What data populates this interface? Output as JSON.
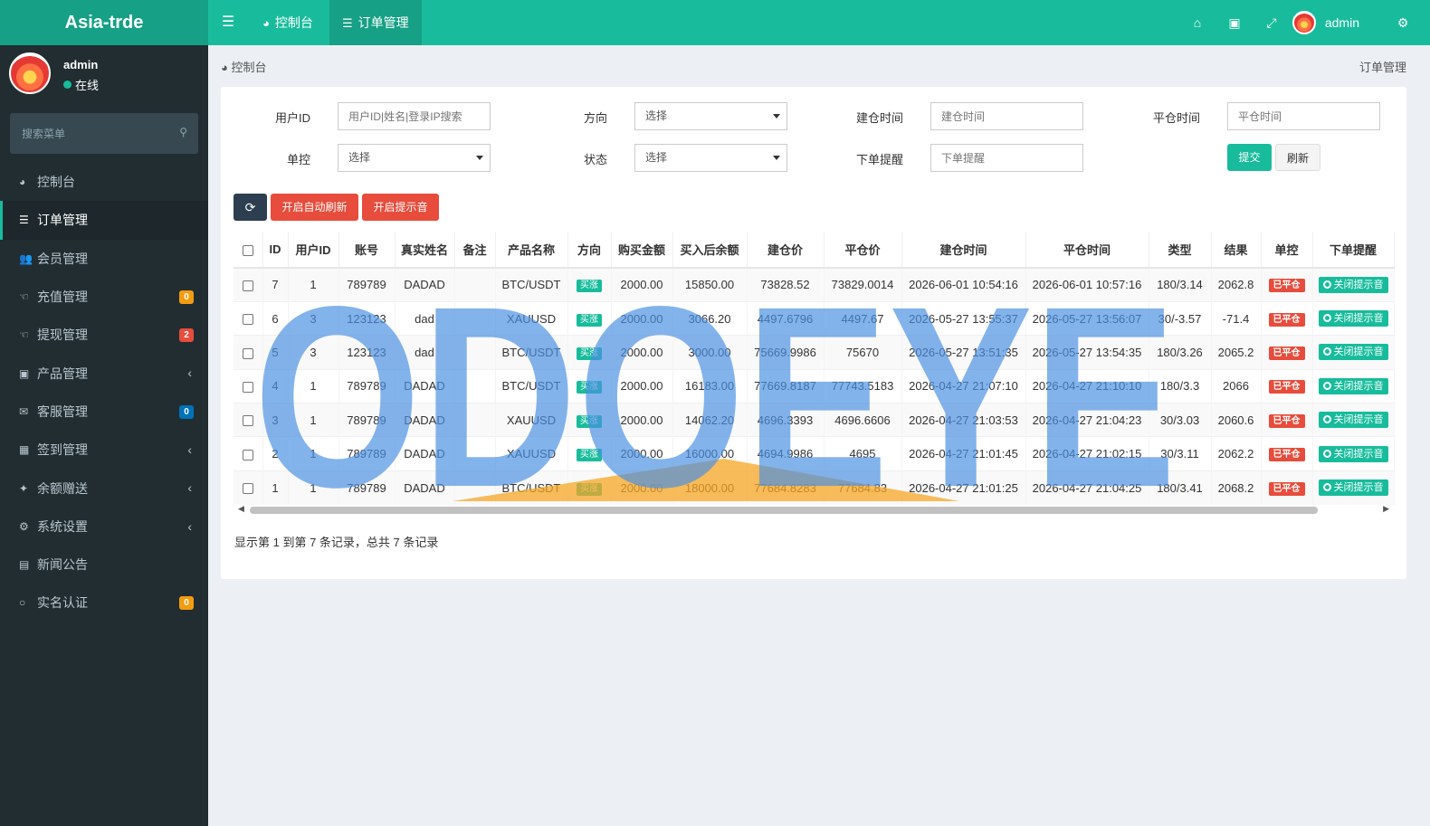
{
  "header": {
    "logo": "Asia-trde",
    "tabs": [
      {
        "label": "控制台",
        "icon": "dashboard-icon"
      },
      {
        "label": "订单管理",
        "icon": "list-icon"
      }
    ],
    "username": "admin"
  },
  "sidebar": {
    "username": "admin",
    "status": "在线",
    "search_placeholder": "搜索菜单",
    "items": [
      {
        "label": "控制台",
        "icon": "dashboard-icon"
      },
      {
        "label": "订单管理",
        "icon": "list-icon",
        "active": true
      },
      {
        "label": "会员管理",
        "icon": "users-icon"
      },
      {
        "label": "充值管理",
        "icon": "hand-icon",
        "badge": "0",
        "badge_color": "#f39c12"
      },
      {
        "label": "提现管理",
        "icon": "hand-icon",
        "badge": "2",
        "badge_color": "#e74c3c"
      },
      {
        "label": "产品管理",
        "icon": "briefcase-icon",
        "chevron": true
      },
      {
        "label": "客服管理",
        "icon": "comments-icon",
        "badge": "0",
        "badge_color": "#0073b7"
      },
      {
        "label": "签到管理",
        "icon": "calendar-icon",
        "chevron": true
      },
      {
        "label": "余额赠送",
        "icon": "gift-icon",
        "chevron": true
      },
      {
        "label": "系统设置",
        "icon": "cogs-icon",
        "chevron": true
      },
      {
        "label": "新闻公告",
        "icon": "newspaper-icon"
      },
      {
        "label": "实名认证",
        "icon": "circle-icon",
        "badge": "0",
        "badge_color": "#f39c12"
      }
    ]
  },
  "breadcrumb": {
    "home": "控制台",
    "current": "订单管理"
  },
  "filters": {
    "user_id": {
      "label": "用户ID",
      "placeholder": "用户ID|姓名|登录IP搜索"
    },
    "direction": {
      "label": "方向",
      "value": "选择"
    },
    "open_time": {
      "label": "建仓时间",
      "placeholder": "建仓时间"
    },
    "close_time": {
      "label": "平仓时间",
      "placeholder": "平仓时间"
    },
    "control": {
      "label": "单控",
      "value": "选择"
    },
    "status": {
      "label": "状态",
      "value": "选择"
    },
    "remind": {
      "label": "下单提醒",
      "placeholder": "下单提醒"
    },
    "submit": "提交",
    "reset": "刷新"
  },
  "toolbar": {
    "auto_refresh": "开启自动刷新",
    "sound": "开启提示音"
  },
  "table": {
    "columns": [
      "ID",
      "用户ID",
      "账号",
      "真实姓名",
      "备注",
      "产品名称",
      "方向",
      "购买金额",
      "买入后余额",
      "建仓价",
      "平仓价",
      "建仓时间",
      "平仓时间",
      "类型",
      "结果",
      "单控",
      "下单提醒"
    ],
    "rows": [
      {
        "id": "7",
        "uid": "1",
        "account": "789789",
        "name": "DADAD",
        "note": "",
        "product": "BTC/USDT",
        "dir": "买涨",
        "amount": "2000.00",
        "balance": "15850.00",
        "open": "73828.52",
        "close": "73829.0014",
        "open_time": "2026-06-01 10:54:16",
        "close_time": "2026-06-01 10:57:16",
        "type": "180/3.14",
        "result": "2062.8",
        "control": "已平仓",
        "remind": "关闭提示音"
      },
      {
        "id": "6",
        "uid": "3",
        "account": "123123",
        "name": "dad",
        "note": "",
        "product": "XAUUSD",
        "dir": "买涨",
        "amount": "2000.00",
        "balance": "3066.20",
        "open": "4497.6796",
        "close": "4497.67",
        "open_time": "2026-05-27 13:55:37",
        "close_time": "2026-05-27 13:56:07",
        "type": "30/-3.57",
        "result": "-71.4",
        "control": "已平仓",
        "remind": "关闭提示音"
      },
      {
        "id": "5",
        "uid": "3",
        "account": "123123",
        "name": "dad",
        "note": "",
        "product": "BTC/USDT",
        "dir": "买涨",
        "amount": "2000.00",
        "balance": "3000.00",
        "open": "75669.9986",
        "close": "75670",
        "open_time": "2026-05-27 13:51:35",
        "close_time": "2026-05-27 13:54:35",
        "type": "180/3.26",
        "result": "2065.2",
        "control": "已平仓",
        "remind": "关闭提示音"
      },
      {
        "id": "4",
        "uid": "1",
        "account": "789789",
        "name": "DADAD",
        "note": "",
        "product": "BTC/USDT",
        "dir": "买涨",
        "amount": "2000.00",
        "balance": "16183.00",
        "open": "77669.8187",
        "close": "77743.5183",
        "open_time": "2026-04-27 21:07:10",
        "close_time": "2026-04-27 21:10:10",
        "type": "180/3.3",
        "result": "2066",
        "control": "已平仓",
        "remind": "关闭提示音"
      },
      {
        "id": "3",
        "uid": "1",
        "account": "789789",
        "name": "DADAD",
        "note": "",
        "product": "XAUUSD",
        "dir": "买涨",
        "amount": "2000.00",
        "balance": "14062.20",
        "open": "4696.3393",
        "close": "4696.6606",
        "open_time": "2026-04-27 21:03:53",
        "close_time": "2026-04-27 21:04:23",
        "type": "30/3.03",
        "result": "2060.6",
        "control": "已平仓",
        "remind": "关闭提示音"
      },
      {
        "id": "2",
        "uid": "1",
        "account": "789789",
        "name": "DADAD",
        "note": "",
        "product": "XAUUSD",
        "dir": "买涨",
        "amount": "2000.00",
        "balance": "16000.00",
        "open": "4694.9986",
        "close": "4695",
        "open_time": "2026-04-27 21:01:45",
        "close_time": "2026-04-27 21:02:15",
        "type": "30/3.11",
        "result": "2062.2",
        "control": "已平仓",
        "remind": "关闭提示音"
      },
      {
        "id": "1",
        "uid": "1",
        "account": "789789",
        "name": "DADAD",
        "note": "",
        "product": "BTC/USDT",
        "dir": "买涨",
        "amount": "2000.00",
        "balance": "18000.00",
        "open": "77684.8283",
        "close": "77684.83",
        "open_time": "2026-04-27 21:01:25",
        "close_time": "2026-04-27 21:04:25",
        "type": "180/3.41",
        "result": "2068.2",
        "control": "已平仓",
        "remind": "关闭提示音"
      }
    ]
  },
  "summary": "显示第 1 到第 7 条记录，总共 7 条记录",
  "watermark": "ODOEYE",
  "colors": {
    "accent": "#18bc9c",
    "sidebar": "#222d32",
    "danger": "#e74c3c"
  }
}
